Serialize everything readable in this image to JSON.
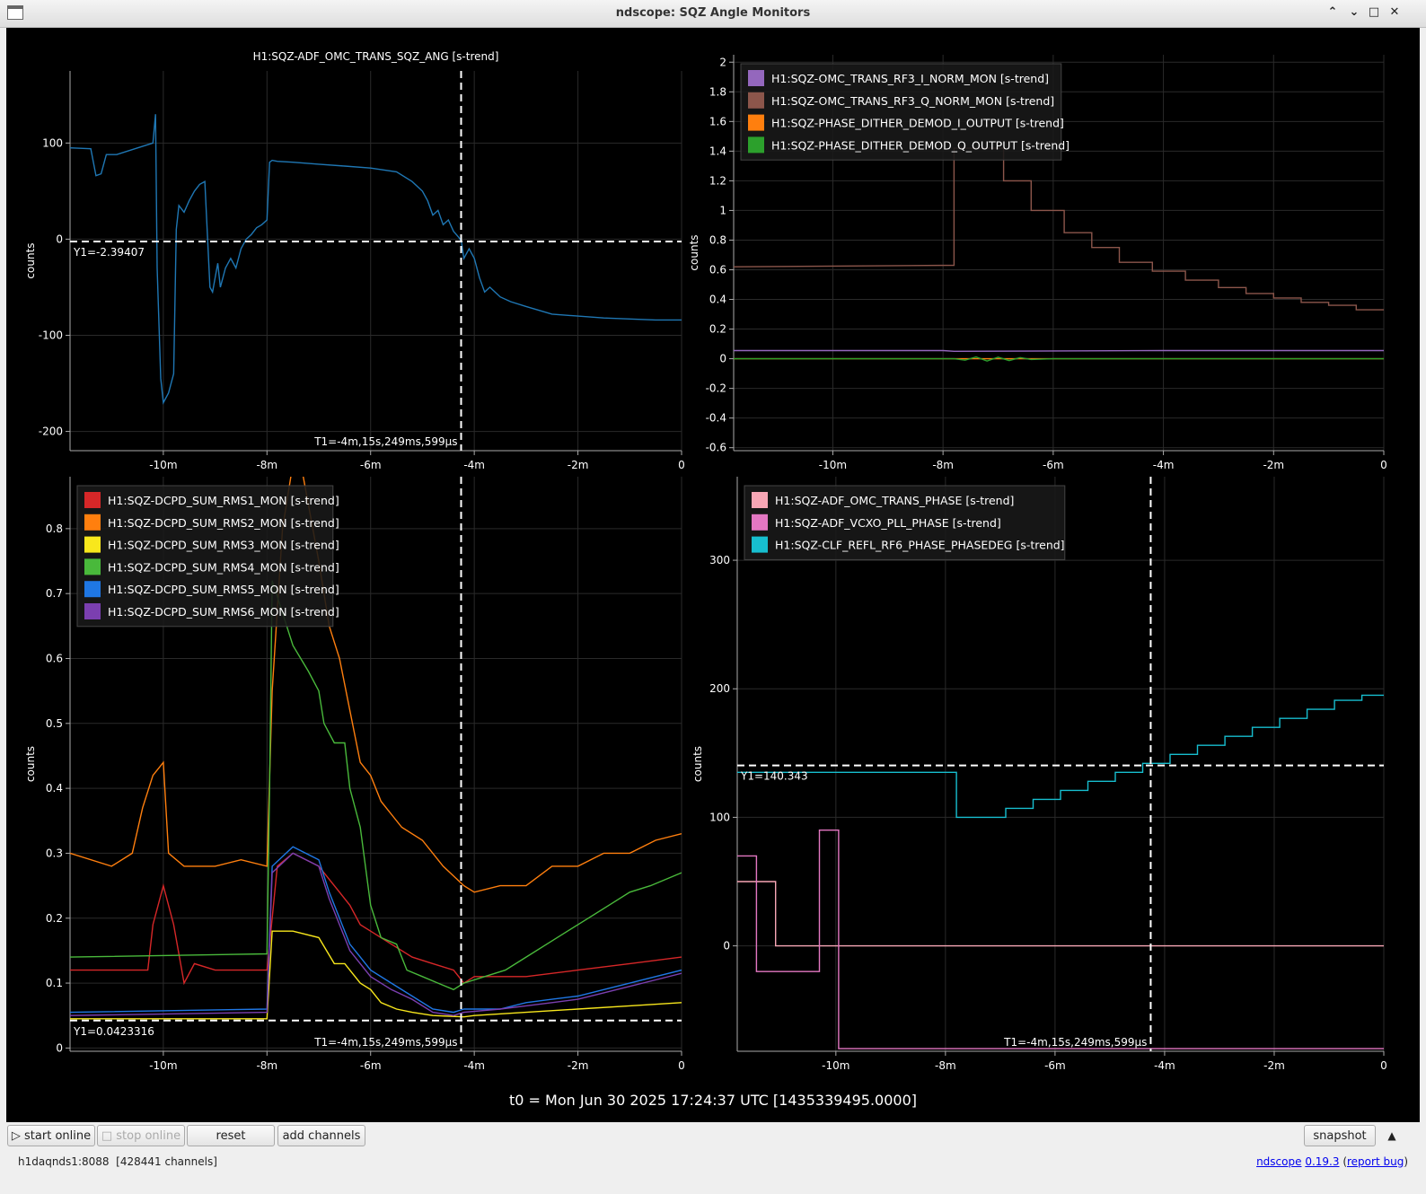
{
  "window": {
    "title": "ndscope: SQZ Angle Monitors"
  },
  "t0_label": "t0 = Mon Jun 30 2025 17:24:37 UTC [1435339495.0000]",
  "toolbar": {
    "start_online": "start online",
    "stop_online": "stop online",
    "reset": "reset",
    "add_channels": "add channels",
    "snapshot": "snapshot"
  },
  "status": {
    "server": "h1daqnds1:8088",
    "channels": "[428441 channels]",
    "app": "ndscope",
    "version": "0.19.3",
    "open_paren": " (",
    "report_bug": "report bug",
    "close_paren": ")"
  },
  "chart_data": [
    {
      "type": "line",
      "title": "H1:SQZ-ADF_OMC_TRANS_SQZ_ANG [s-trend]",
      "ylabel": "counts",
      "xlim": [
        -11.8,
        0
      ],
      "ylim": [
        -220,
        175
      ],
      "xticks": [
        -10,
        -8,
        -6,
        -4,
        -2,
        0
      ],
      "xtick_labels": [
        "-10m",
        "-8m",
        "-6m",
        "-4m",
        "-2m",
        "0"
      ],
      "yticks": [
        100,
        0,
        -100,
        -200
      ],
      "ytick_labels": [
        "100",
        "0",
        "-100",
        "-200"
      ],
      "cursor": {
        "t": -4.254,
        "t_label": "T1=-4m,15s,249ms,599µs",
        "y": -2.39407,
        "y_label": "Y1=-2.39407"
      },
      "series": [
        {
          "name": "H1:SQZ-ADF_OMC_TRANS_SQZ_ANG [s-trend]",
          "color": "#1f77b4",
          "x": [
            -11.8,
            -11.4,
            -11.3,
            -11.2,
            -11.1,
            -10.9,
            -10.2,
            -10.15,
            -10.12,
            -10.05,
            -10.0,
            -9.9,
            -9.8,
            -9.75,
            -9.7,
            -9.6,
            -9.5,
            -9.4,
            -9.3,
            -9.2,
            -9.1,
            -9.05,
            -9.0,
            -8.95,
            -8.9,
            -8.8,
            -8.7,
            -8.6,
            -8.5,
            -8.4,
            -8.3,
            -8.2,
            -8.1,
            -8.0,
            -7.95,
            -7.9,
            -7.8,
            -7.5,
            -7.0,
            -6.5,
            -6.0,
            -5.5,
            -5.2,
            -5.0,
            -4.9,
            -4.8,
            -4.7,
            -4.6,
            -4.5,
            -4.4,
            -4.3,
            -4.25,
            -4.2,
            -4.1,
            -4.0,
            -3.9,
            -3.8,
            -3.7,
            -3.6,
            -3.5,
            -3.3,
            -3.0,
            -2.5,
            -2.0,
            -1.5,
            -1.0,
            -0.5,
            0
          ],
          "y": [
            95,
            94,
            66,
            68,
            88,
            88,
            100,
            130,
            -30,
            -145,
            -170,
            -160,
            -140,
            10,
            35,
            28,
            40,
            50,
            57,
            60,
            -50,
            -55,
            -40,
            -25,
            -50,
            -30,
            -20,
            -30,
            -10,
            0,
            5,
            12,
            15,
            20,
            80,
            82,
            81,
            80,
            78,
            76,
            74,
            70,
            60,
            50,
            40,
            25,
            30,
            15,
            20,
            8,
            2,
            -2,
            -20,
            -10,
            -20,
            -40,
            -55,
            -50,
            -55,
            -60,
            -65,
            -70,
            -78,
            -80,
            -82,
            -83,
            -84,
            -84
          ]
        }
      ]
    },
    {
      "type": "line",
      "title": "",
      "ylabel": "counts",
      "xlim": [
        -11.8,
        0
      ],
      "ylim": [
        -0.62,
        2.05
      ],
      "xticks": [
        -10,
        -8,
        -6,
        -4,
        -2,
        0
      ],
      "xtick_labels": [
        "-10m",
        "-8m",
        "-6m",
        "-4m",
        "-2m",
        "0"
      ],
      "yticks": [
        2,
        1.8,
        1.6,
        1.4,
        1.2,
        1,
        0.8,
        0.6,
        0.4,
        0.2,
        0,
        -0.2,
        -0.4,
        -0.6
      ],
      "ytick_labels": [
        "2",
        "1.8",
        "1.6",
        "1.4",
        "1.2",
        "1",
        "0.8",
        "0.6",
        "0.4",
        "0.2",
        "0",
        "-0.2",
        "-0.4",
        "-0.6"
      ],
      "legend": "top-left",
      "series": [
        {
          "name": "H1:SQZ-OMC_TRANS_RF3_I_NORM_MON [s-trend]",
          "color": "#9467bd",
          "x": [
            -11.8,
            -8,
            -7.8,
            -4,
            0
          ],
          "y": [
            0.055,
            0.055,
            0.05,
            0.055,
            0.055
          ]
        },
        {
          "name": "H1:SQZ-OMC_TRANS_RF3_Q_NORM_MON [s-trend]",
          "color": "#8c564b",
          "x": [
            -11.8,
            -7.8,
            -7.8,
            -6.9,
            -6.9,
            -6.4,
            -6.4,
            -5.8,
            -5.8,
            -5.3,
            -5.3,
            -4.8,
            -4.8,
            -4.2,
            -4.2,
            -3.6,
            -3.6,
            -3.0,
            -3.0,
            -2.5,
            -2.5,
            -2.0,
            -2.0,
            -1.5,
            -1.5,
            -1.0,
            -1.0,
            -0.5,
            -0.5,
            0
          ],
          "y": [
            0.62,
            0.63,
            1.42,
            1.42,
            1.2,
            1.2,
            1.0,
            1.0,
            0.85,
            0.85,
            0.75,
            0.75,
            0.65,
            0.65,
            0.59,
            0.59,
            0.53,
            0.53,
            0.48,
            0.48,
            0.44,
            0.44,
            0.41,
            0.41,
            0.38,
            0.38,
            0.36,
            0.36,
            0.33,
            0.33
          ]
        },
        {
          "name": "H1:SQZ-PHASE_DITHER_DEMOD_I_OUTPUT [s-trend]",
          "color": "#ff7f0e",
          "x": [
            -11.8,
            0
          ],
          "y": [
            0.0,
            0.0
          ]
        },
        {
          "name": "H1:SQZ-PHASE_DITHER_DEMOD_Q_OUTPUT [s-trend]",
          "color": "#2ca02c",
          "x": [
            -11.8,
            -7.8,
            -7.6,
            -7.4,
            -7.2,
            -7.0,
            -6.8,
            -6.6,
            -6.4,
            -6.0,
            0
          ],
          "y": [
            0,
            0,
            -0.01,
            0.012,
            -0.015,
            0.01,
            -0.012,
            0.008,
            -0.005,
            0,
            0
          ]
        }
      ]
    },
    {
      "type": "line",
      "title": "",
      "ylabel": "counts",
      "xlim": [
        -11.8,
        0
      ],
      "ylim": [
        -0.005,
        0.88
      ],
      "xticks": [
        -10,
        -8,
        -6,
        -4,
        -2,
        0
      ],
      "xtick_labels": [
        "-10m",
        "-8m",
        "-6m",
        "-4m",
        "-2m",
        "0"
      ],
      "yticks": [
        0.8,
        0.7,
        0.6,
        0.5,
        0.4,
        0.3,
        0.2,
        0.1,
        0
      ],
      "ytick_labels": [
        "0.8",
        "0.7",
        "0.6",
        "0.5",
        "0.4",
        "0.3",
        "0.2",
        "0.1",
        "0"
      ],
      "legend": "top-left",
      "cursor": {
        "t": -4.254,
        "t_label": "T1=-4m,15s,249ms,599µs",
        "y": 0.0423316,
        "y_label": "Y1=0.0423316"
      },
      "series": [
        {
          "name": "H1:SQZ-DCPD_SUM_RMS1_MON [s-trend]",
          "color": "#d62728",
          "x": [
            -11.8,
            -10.3,
            -10.2,
            -10.0,
            -9.8,
            -9.6,
            -9.4,
            -9.0,
            -8.0,
            -7.9,
            -7.8,
            -7.5,
            -7.0,
            -6.8,
            -6.6,
            -6.4,
            -6.2,
            -6.0,
            -5.6,
            -5.2,
            -4.8,
            -4.4,
            -4.2,
            -4.0,
            -3.0,
            -2.0,
            -1.0,
            0
          ],
          "y": [
            0.12,
            0.12,
            0.19,
            0.25,
            0.19,
            0.1,
            0.13,
            0.12,
            0.12,
            0.2,
            0.28,
            0.3,
            0.28,
            0.26,
            0.24,
            0.22,
            0.19,
            0.18,
            0.16,
            0.14,
            0.13,
            0.12,
            0.1,
            0.11,
            0.11,
            0.12,
            0.13,
            0.14
          ]
        },
        {
          "name": "H1:SQZ-DCPD_SUM_RMS2_MON [s-trend]",
          "color": "#ff7f0e",
          "x": [
            -11.8,
            -11.0,
            -10.6,
            -10.4,
            -10.2,
            -10.0,
            -9.9,
            -9.6,
            -9.0,
            -8.5,
            -8.0,
            -7.9,
            -7.7,
            -7.5,
            -7.3,
            -7.0,
            -6.8,
            -6.6,
            -6.4,
            -6.2,
            -6.0,
            -5.8,
            -5.6,
            -5.4,
            -5.0,
            -4.6,
            -4.2,
            -4.0,
            -3.5,
            -3.0,
            -2.5,
            -2.0,
            -1.5,
            -1.0,
            -0.5,
            0
          ],
          "y": [
            0.3,
            0.28,
            0.3,
            0.37,
            0.42,
            0.44,
            0.3,
            0.28,
            0.28,
            0.29,
            0.28,
            0.55,
            0.8,
            0.9,
            0.88,
            0.75,
            0.65,
            0.6,
            0.52,
            0.44,
            0.42,
            0.38,
            0.36,
            0.34,
            0.32,
            0.28,
            0.25,
            0.24,
            0.25,
            0.25,
            0.28,
            0.28,
            0.3,
            0.3,
            0.32,
            0.33
          ]
        },
        {
          "name": "H1:SQZ-DCPD_SUM_RMS3_MON [s-trend]",
          "color": "#f8e71c",
          "x": [
            -11.8,
            -8.0,
            -7.9,
            -7.5,
            -7.0,
            -6.7,
            -6.5,
            -6.2,
            -6.0,
            -5.8,
            -5.5,
            -5.2,
            -4.8,
            -4.2,
            -4.0,
            -3.0,
            -2.0,
            -1.0,
            0
          ],
          "y": [
            0.045,
            0.045,
            0.18,
            0.18,
            0.17,
            0.13,
            0.13,
            0.1,
            0.09,
            0.07,
            0.06,
            0.055,
            0.05,
            0.048,
            0.05,
            0.055,
            0.06,
            0.065,
            0.07
          ]
        },
        {
          "name": "H1:SQZ-DCPD_SUM_RMS4_MON [s-trend]",
          "color": "#49b93b",
          "x": [
            -11.8,
            -8.0,
            -7.95,
            -7.9,
            -7.5,
            -7.2,
            -7.0,
            -6.9,
            -6.7,
            -6.5,
            -6.4,
            -6.2,
            -6.0,
            -5.8,
            -5.5,
            -5.3,
            -5.0,
            -4.7,
            -4.4,
            -4.2,
            -3.8,
            -3.4,
            -3.0,
            -2.6,
            -2.2,
            -1.8,
            -1.4,
            -1.0,
            -0.6,
            0
          ],
          "y": [
            0.14,
            0.145,
            0.4,
            0.72,
            0.62,
            0.58,
            0.55,
            0.5,
            0.47,
            0.47,
            0.4,
            0.34,
            0.22,
            0.17,
            0.16,
            0.12,
            0.11,
            0.1,
            0.09,
            0.1,
            0.11,
            0.12,
            0.14,
            0.16,
            0.18,
            0.2,
            0.22,
            0.24,
            0.25,
            0.27
          ]
        },
        {
          "name": "H1:SQZ-DCPD_SUM_RMS5_MON [s-trend]",
          "color": "#1f77e4",
          "x": [
            -11.8,
            -8.0,
            -7.9,
            -7.5,
            -7.0,
            -6.8,
            -6.6,
            -6.4,
            -6.2,
            -6.0,
            -5.6,
            -5.2,
            -4.8,
            -4.4,
            -4.2,
            -3.5,
            -3.0,
            -2.5,
            -2.0,
            -1.5,
            -1.0,
            -0.5,
            0
          ],
          "y": [
            0.055,
            0.06,
            0.28,
            0.31,
            0.29,
            0.24,
            0.2,
            0.16,
            0.14,
            0.12,
            0.1,
            0.08,
            0.06,
            0.055,
            0.06,
            0.06,
            0.07,
            0.075,
            0.08,
            0.09,
            0.1,
            0.11,
            0.12
          ]
        },
        {
          "name": "H1:SQZ-DCPD_SUM_RMS6_MON [s-trend]",
          "color": "#7b3fb0",
          "x": [
            -11.8,
            -8.0,
            -7.9,
            -7.5,
            -7.0,
            -6.8,
            -6.6,
            -6.4,
            -6.2,
            -6.0,
            -5.6,
            -5.2,
            -4.8,
            -4.4,
            -4.2,
            -3.5,
            -3.0,
            -2.5,
            -2.0,
            -1.5,
            -1.0,
            -0.5,
            0
          ],
          "y": [
            0.05,
            0.055,
            0.27,
            0.3,
            0.28,
            0.23,
            0.19,
            0.15,
            0.13,
            0.11,
            0.09,
            0.075,
            0.055,
            0.05,
            0.055,
            0.06,
            0.065,
            0.07,
            0.075,
            0.085,
            0.095,
            0.105,
            0.115
          ]
        }
      ]
    },
    {
      "type": "line",
      "title": "",
      "ylabel": "counts",
      "xlim": [
        -11.8,
        0
      ],
      "ylim": [
        -82,
        365
      ],
      "xticks": [
        -10,
        -8,
        -6,
        -4,
        -2,
        0
      ],
      "xtick_labels": [
        "-10m",
        "-8m",
        "-6m",
        "-4m",
        "-2m",
        "0"
      ],
      "yticks": [
        300,
        200,
        100,
        0
      ],
      "ytick_labels": [
        "300",
        "200",
        "100",
        "0"
      ],
      "legend": "top-left",
      "cursor": {
        "t": -4.254,
        "t_label": "T1=-4m,15s,249ms,599µs",
        "y": 140.343,
        "y_label": "Y1=140.343"
      },
      "series": [
        {
          "name": "H1:SQZ-ADF_OMC_TRANS_PHASE [s-trend]",
          "color": "#f7a6b5",
          "x": [
            -11.8,
            -11.1,
            -11.1,
            -10.4,
            -10.4,
            -10.0,
            -10.0,
            -0.0
          ],
          "y": [
            50,
            50,
            0,
            0,
            0,
            0,
            0,
            0
          ]
        },
        {
          "name": "H1:SQZ-ADF_VCXO_PLL_PHASE [s-trend]",
          "color": "#e377c2",
          "x": [
            -11.8,
            -11.45,
            -11.45,
            -10.3,
            -10.3,
            -9.95,
            -9.95,
            -9.6,
            -9.6,
            -9.3,
            -9.3,
            -0.0
          ],
          "y": [
            70,
            70,
            -20,
            -20,
            90,
            90,
            -80,
            -80,
            -80,
            -80,
            -80,
            -80
          ]
        },
        {
          "name": "H1:SQZ-CLF_REFL_RF6_PHASE_PHASEDEG [s-trend]",
          "color": "#17becf",
          "x": [
            -11.8,
            -7.8,
            -7.8,
            -6.9,
            -6.9,
            -6.4,
            -6.4,
            -5.9,
            -5.9,
            -5.4,
            -5.4,
            -4.9,
            -4.9,
            -4.4,
            -4.4,
            -3.9,
            -3.9,
            -3.4,
            -3.4,
            -2.9,
            -2.9,
            -2.4,
            -2.4,
            -1.9,
            -1.9,
            -1.4,
            -1.4,
            -0.9,
            -0.9,
            -0.4,
            -0.4,
            0
          ],
          "y": [
            135,
            135,
            100,
            100,
            107,
            107,
            114,
            114,
            121,
            121,
            128,
            128,
            135,
            135,
            142,
            142,
            149,
            149,
            156,
            156,
            163,
            163,
            170,
            170,
            177,
            177,
            184,
            184,
            191,
            191,
            195,
            195
          ]
        }
      ]
    }
  ]
}
